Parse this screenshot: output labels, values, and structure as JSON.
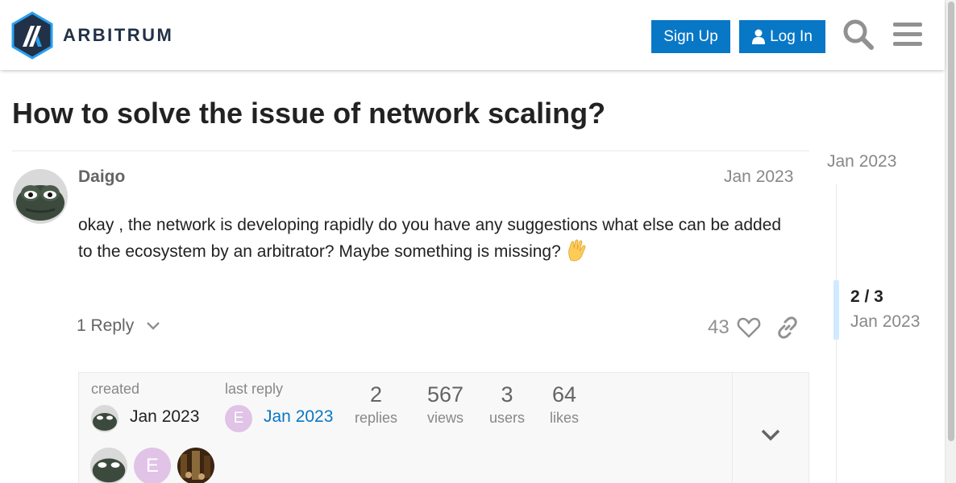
{
  "header": {
    "brand": "ARBITRUM",
    "signup_label": "Sign Up",
    "login_label": "Log In"
  },
  "topic": {
    "title": "How to solve the issue of network scaling?"
  },
  "post": {
    "username": "Daigo",
    "date": "Jan 2023",
    "body": "okay , the network is developing rapidly do you have any suggestions what else can be added to the ecosystem by an arbitrator? Maybe something is missing?",
    "reply_label": "1 Reply",
    "like_count": "43"
  },
  "summary": {
    "created_label": "created",
    "created_date": "Jan 2023",
    "last_reply_label": "last reply",
    "last_reply_date": "Jan 2023",
    "last_reply_avatar_letter": "E",
    "stats": [
      {
        "num": "2",
        "label": "replies"
      },
      {
        "num": "567",
        "label": "views"
      },
      {
        "num": "3",
        "label": "users"
      },
      {
        "num": "64",
        "label": "likes"
      }
    ],
    "participant_letter": "E"
  },
  "timeline": {
    "top_date": "Jan 2023",
    "position": "2 / 3",
    "position_date": "Jan 2023"
  },
  "colors": {
    "accent": "#0877c6",
    "brand_navy": "#213147",
    "timeline_handle": "#d1eaff",
    "avatar_letter_bg": "#e0c3e6"
  }
}
